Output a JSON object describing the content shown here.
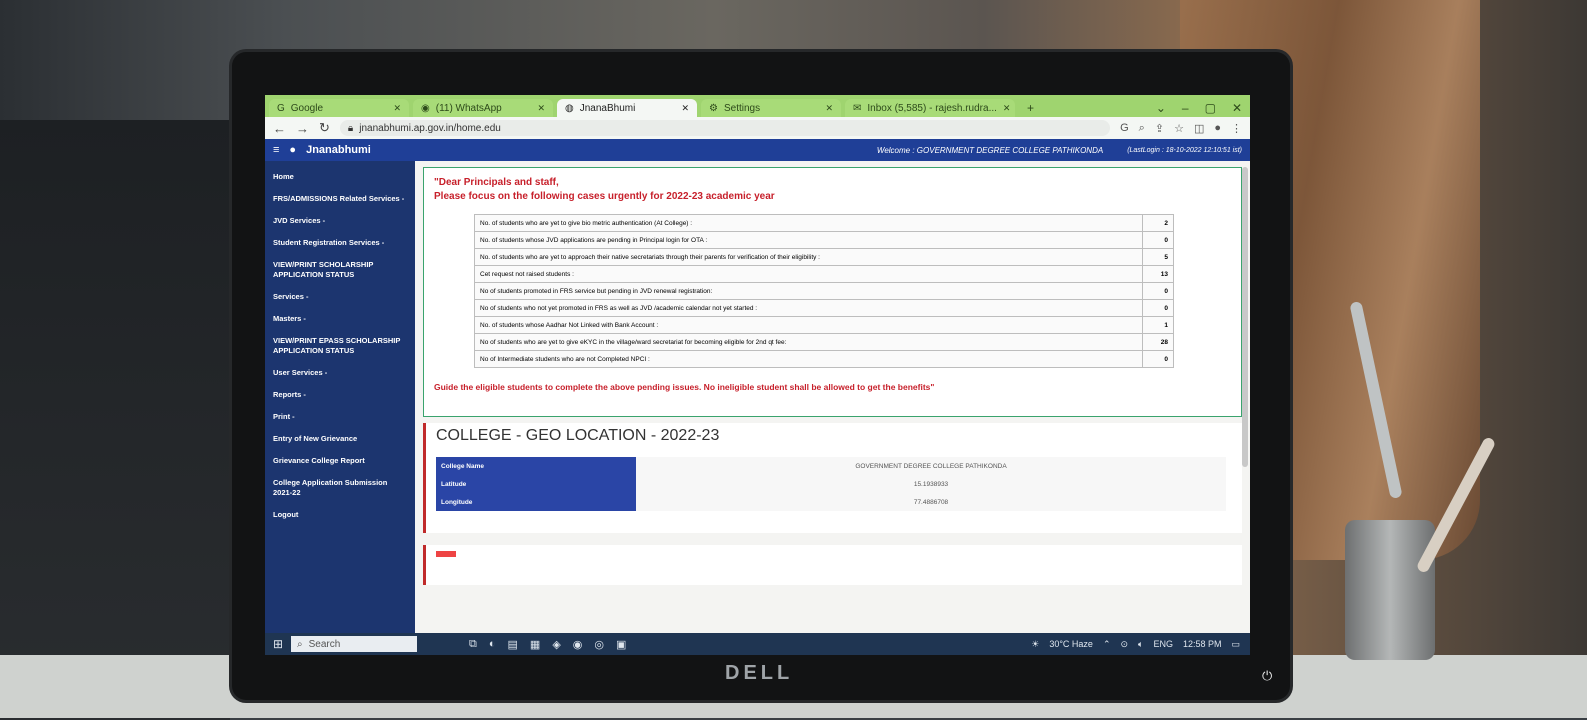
{
  "browser": {
    "tabs": [
      {
        "icon": "google-icon",
        "label": "Google",
        "active": false
      },
      {
        "icon": "whatsapp-icon",
        "label": "(11) WhatsApp",
        "active": false
      },
      {
        "icon": "globe-icon",
        "label": "JnanaBhumi",
        "active": true
      },
      {
        "icon": "settings-icon",
        "label": "Settings",
        "active": false
      },
      {
        "icon": "mail-icon",
        "label": "Inbox (5,585) - rajesh.rudra...",
        "active": false
      }
    ],
    "new_tab": "+",
    "url": "jnanabhumi.ap.gov.in/home.edu"
  },
  "app": {
    "logo_text": "Jnanabhumi",
    "welcome": "Welcome : GOVERNMENT DEGREE COLLEGE PATHIKONDA",
    "last_login": "(LastLogin : 18-10-2022 12:10:51 ist)"
  },
  "sidebar": {
    "items": [
      "Home",
      "FRS/ADMISSIONS Related Services -",
      "JVD Services -",
      "Student Registration Services -",
      "VIEW/PRINT SCHOLARSHIP APPLICATION STATUS",
      "Services -",
      "Masters -",
      "VIEW/PRINT EPASS SCHOLARSHIP APPLICATION STATUS",
      "User Services -",
      "Reports -",
      "Print -",
      "Entry of New Grievance",
      "Grievance College Report",
      "College Application Submission 2021-22",
      "Logout"
    ]
  },
  "notice": {
    "line1": "\"Dear Principals and staff,",
    "line2": "Please focus on the following cases urgently for 2022-23 academic year",
    "cases": [
      {
        "label": "No. of students who are yet to give bio metric authentication (At College) :",
        "value": "2"
      },
      {
        "label": "No. of students whose JVD applications are pending in Principal login for OTA :",
        "value": "0"
      },
      {
        "label": "No. of students who are yet to approach their native secretariats through their parents for verification of their eligibility :",
        "value": "5"
      },
      {
        "label": "Cet request not raised students :",
        "value": "13"
      },
      {
        "label": "No of students promoted in FRS service but pending in JVD renewal registration:",
        "value": "0"
      },
      {
        "label": "No of students who not yet promoted in FRS as well as JVD /academic calendar not yet started :",
        "value": "0"
      },
      {
        "label": "No. of students whose Aadhar Not Linked with Bank Account :",
        "value": "1"
      },
      {
        "label": "No of students who are yet to give eKYC in the village/ward secretariat for becoming eligible for 2nd qt fee:",
        "value": "28"
      },
      {
        "label": "No of Intermediate students who are not Completed NPCI :",
        "value": "0"
      }
    ],
    "guide": "Guide the eligible students to complete the above pending issues. No ineligible student shall be allowed to get the benefits\""
  },
  "geo": {
    "title": "COLLEGE - GEO LOCATION - 2022-23",
    "rows": [
      {
        "key": "College Name",
        "value": "GOVERNMENT DEGREE COLLEGE PATHIKONDA"
      },
      {
        "key": "Latitude",
        "value": "15.1938933"
      },
      {
        "key": "Longitude",
        "value": "77.4886708"
      }
    ]
  },
  "taskbar": {
    "search_placeholder": "Search",
    "weather": "30°C Haze",
    "language": "ENG",
    "time": "12:58 PM"
  },
  "monitor": {
    "brand": "DELL"
  }
}
